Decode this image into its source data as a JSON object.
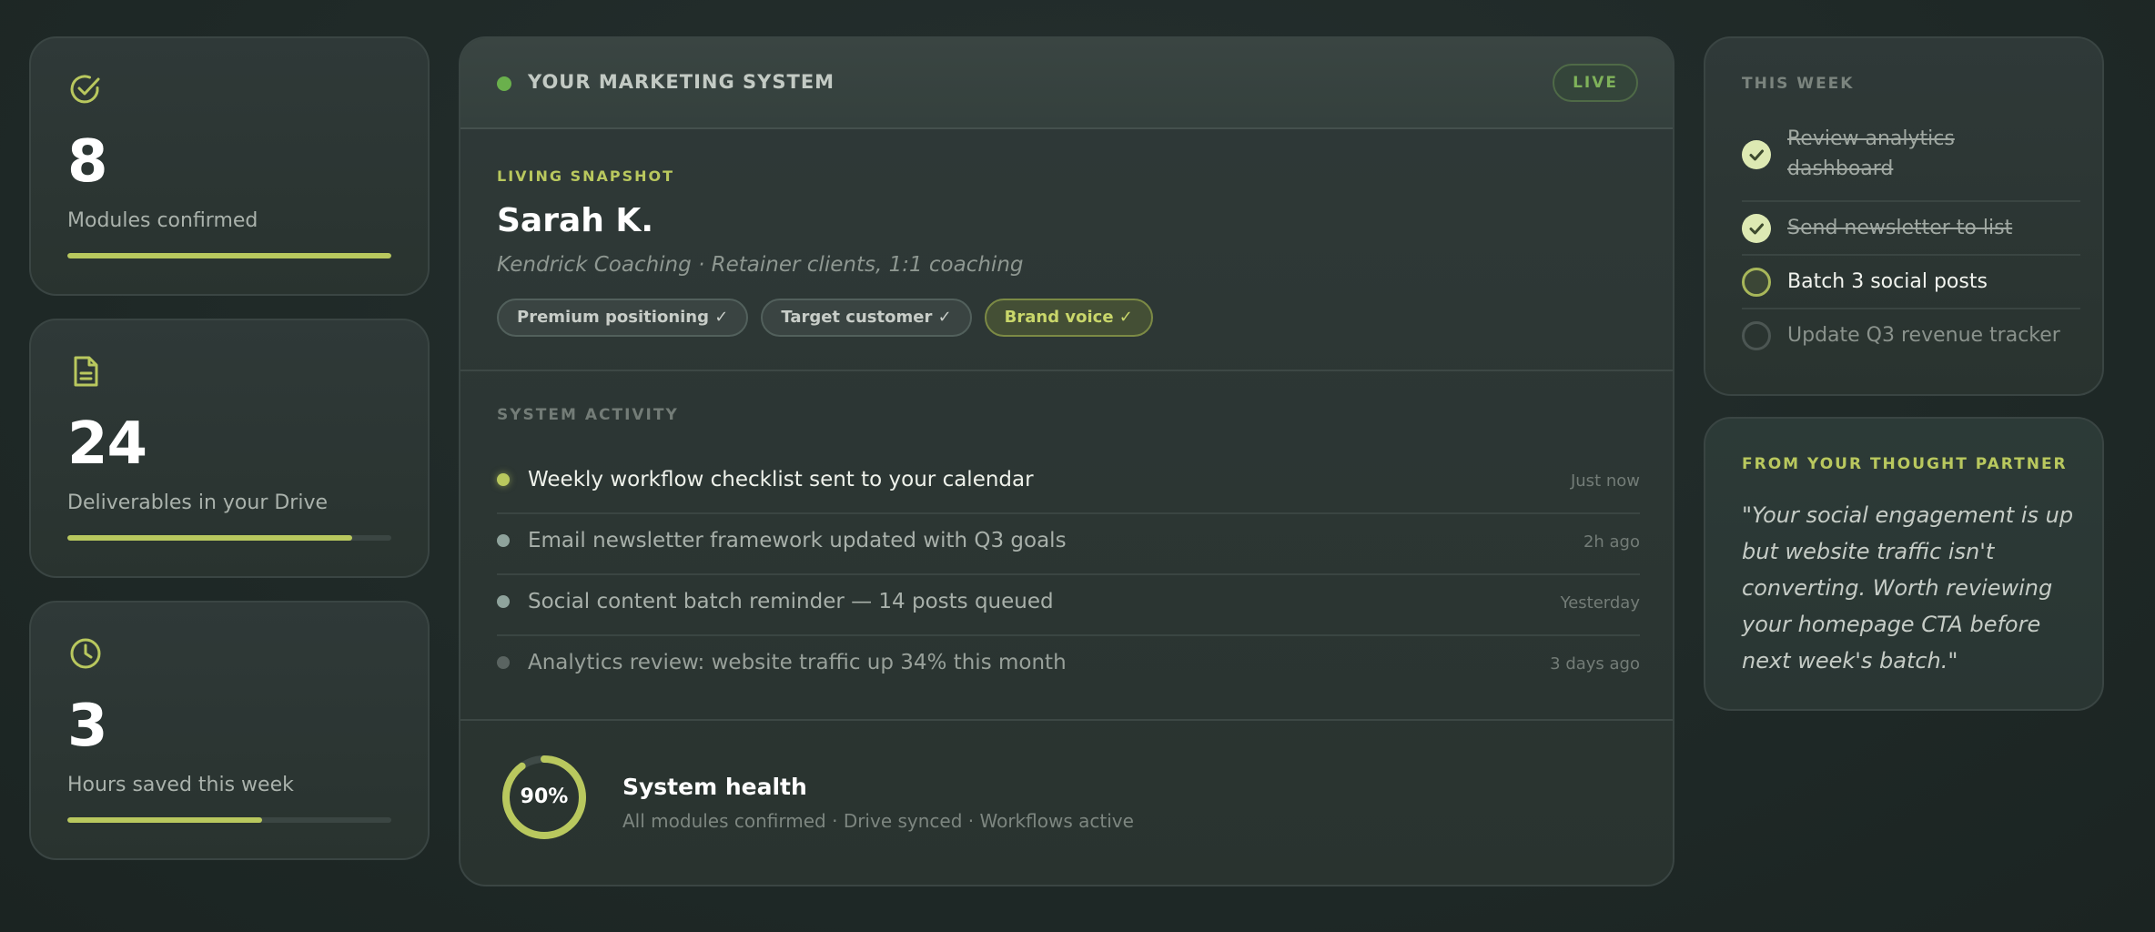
{
  "stats": [
    {
      "icon": "check-circle-icon",
      "value": "8",
      "label": "Modules confirmed",
      "progress": 1.0
    },
    {
      "icon": "document-icon",
      "value": "24",
      "label": "Deliverables in your Drive",
      "progress": 0.88
    },
    {
      "icon": "clock-icon",
      "value": "3",
      "label": "Hours saved this week",
      "progress": 0.6
    }
  ],
  "system": {
    "title": "YOUR MARKETING SYSTEM",
    "status": "LIVE"
  },
  "snapshot": {
    "label": "LIVING SNAPSHOT",
    "name": "Sarah K.",
    "subtitle": "Kendrick Coaching · Retainer clients, 1:1 coaching",
    "tags": [
      "Premium positioning ✓",
      "Target customer ✓",
      "Brand voice ✓"
    ]
  },
  "activity": {
    "label": "SYSTEM ACTIVITY",
    "items": [
      {
        "text": "Weekly workflow checklist sent to your calendar",
        "time": "Just now"
      },
      {
        "text": "Email newsletter framework updated with Q3 goals",
        "time": "2h ago"
      },
      {
        "text": "Social content batch reminder — 14 posts queued",
        "time": "Yesterday"
      },
      {
        "text": "Analytics review: website traffic up 34% this month",
        "time": "3 days ago"
      }
    ]
  },
  "health": {
    "percent_label": "90%",
    "value": 0.9,
    "title": "System health",
    "subtitle": "All modules confirmed · Drive synced · Workflows active"
  },
  "this_week": {
    "label": "THIS WEEK",
    "tasks": [
      {
        "text": "Review analytics dashboard",
        "state": "done"
      },
      {
        "text": "Send newsletter to list",
        "state": "done"
      },
      {
        "text": "Batch 3 social posts",
        "state": "in-progress"
      },
      {
        "text": "Update Q3 revenue tracker",
        "state": "todo"
      }
    ]
  },
  "partner": {
    "label": "FROM YOUR THOUGHT PARTNER",
    "quote": "\"Your social engagement is up but website traffic isn't converting. Worth reviewing your homepage CTA before next week's batch.\""
  },
  "colors": {
    "accent": "#b9c85e",
    "live_green": "#6ab04c",
    "background": "#1f2927"
  }
}
